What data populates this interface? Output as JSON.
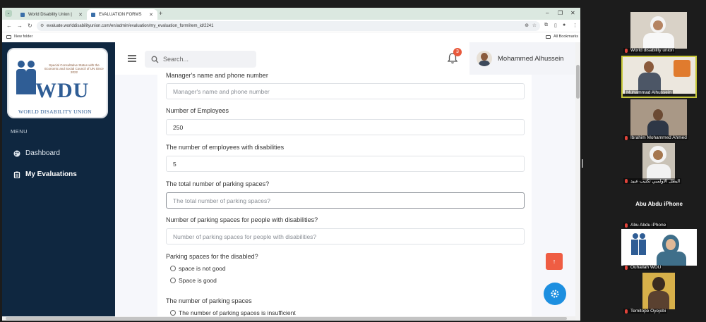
{
  "browser": {
    "tabs": [
      {
        "title": "World Disability Union |",
        "active": false
      },
      {
        "title": "EVALUATION FORMS",
        "active": true
      }
    ],
    "new_tab": "+",
    "window_controls": {
      "minimize": "–",
      "restore": "❐",
      "close": "✕"
    },
    "url": "evaluate.worlddisabilityunion.com/en/admin/evaluation/my_evaluation_form/item_id/2241",
    "bookmarks": {
      "left": "New folder",
      "right": "All Bookmarks"
    }
  },
  "sidebar": {
    "logo": {
      "tagline": "Special Consultative Status with the Economic and Social Council of UN Since 2022",
      "letters": "WDU",
      "name": "WORLD DISABILITY UNION"
    },
    "menu_heading": "MENU",
    "items": [
      {
        "label": "Dashboard",
        "icon": "palette-icon"
      },
      {
        "label": "My Evaluations",
        "icon": "clipboard-icon"
      }
    ]
  },
  "topbar": {
    "search_placeholder": "Search...",
    "notification_count": "3",
    "user_name": "Mohammed Alhussein"
  },
  "form": {
    "q_manager": {
      "label": "Manager's name and phone number",
      "placeholder": "Manager's name and phone number",
      "value": ""
    },
    "q_employees": {
      "label": "Number of Employees",
      "value": "250"
    },
    "q_employees_disab": {
      "label": "The number of employees with disabilities",
      "value": "5"
    },
    "q_parking_total": {
      "label": "The total number of parking spaces?",
      "placeholder": "The total number of parking spaces?",
      "value": ""
    },
    "q_parking_disab": {
      "label": "Number of parking spaces for people with disabilities?",
      "placeholder": "Number of parking spaces for people with disabilities?",
      "value": ""
    },
    "q_parking_quality": {
      "label": "Parking spaces for the disabled?",
      "options": [
        "space is not good",
        "Space is good"
      ]
    },
    "q_parking_count": {
      "label": "The number of parking spaces",
      "options": [
        "The number of parking spaces is insufficient"
      ]
    }
  },
  "fab": {
    "scroll_top": "↑"
  },
  "colors": {
    "sidebar": "#0f2740",
    "accent_red": "#ef5d43",
    "accent_blue": "#1d8fe0",
    "badge": "#e8593c"
  },
  "meeting": {
    "participants": [
      {
        "name": "World disability union",
        "muted": true
      },
      {
        "name": "Muhammad Alhussein",
        "muted": false,
        "active": true
      },
      {
        "name": "Ibrahim Mohammed Ahmed",
        "muted": true
      },
      {
        "name": "البطل الاولمبي تكتيب عبيد",
        "muted": true
      },
      {
        "name": "Abu Abdu iPhone",
        "display": "Abu Abdu iPhone",
        "muted": true
      },
      {
        "name": "Ouhailah WDU",
        "muted": true
      },
      {
        "name": "Temitope Oyejobi",
        "muted": true
      }
    ]
  }
}
